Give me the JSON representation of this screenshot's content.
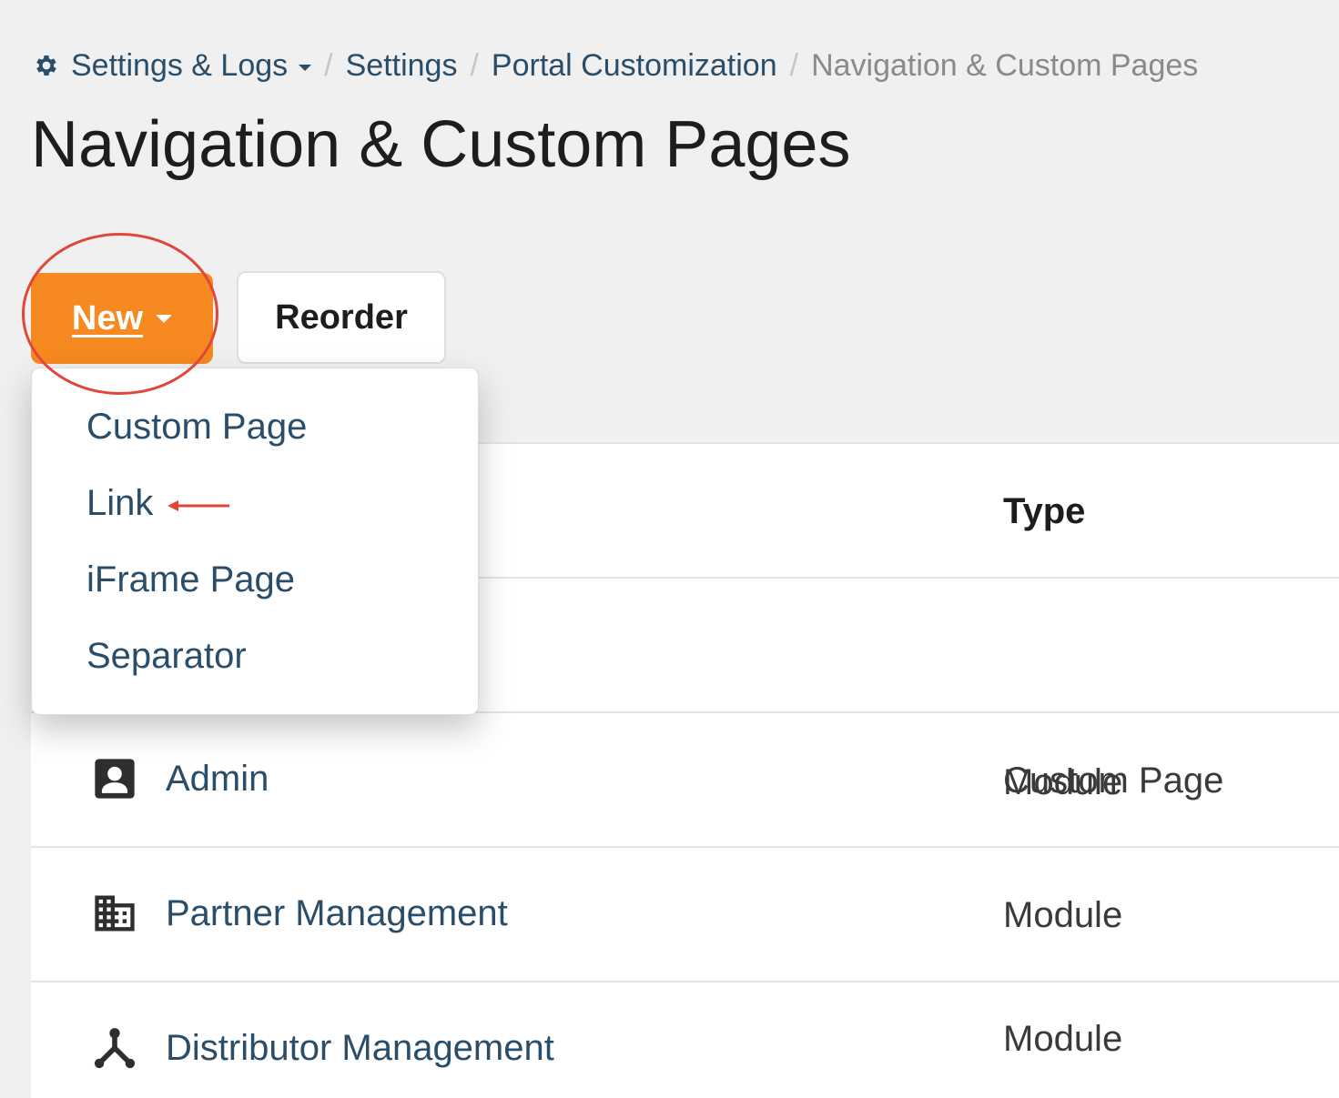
{
  "breadcrumb": {
    "items": [
      "Settings & Logs",
      "Settings",
      "Portal Customization",
      "Navigation & Custom Pages"
    ],
    "separator": "/"
  },
  "page": {
    "title": "Navigation & Custom Pages"
  },
  "toolbar": {
    "new_label": "New",
    "reorder_label": "Reorder"
  },
  "dropdown": {
    "items": [
      "Custom Page",
      "Link",
      "iFrame Page",
      "Separator"
    ]
  },
  "table": {
    "columns": [
      "Type"
    ],
    "rows": [
      {
        "name": "",
        "type": "Custom Page",
        "icon": ""
      },
      {
        "name": "Admin",
        "type": "Module",
        "icon": "contact-card-icon"
      },
      {
        "name": "Partner Management",
        "type": "Module",
        "icon": "building-icon"
      },
      {
        "name": "Distributor Management",
        "type": "Module",
        "icon": "hierarchy-icon"
      }
    ]
  },
  "colors": {
    "accent": "#f6891f",
    "link": "#2a4d69",
    "annotation": "#e0473a"
  }
}
